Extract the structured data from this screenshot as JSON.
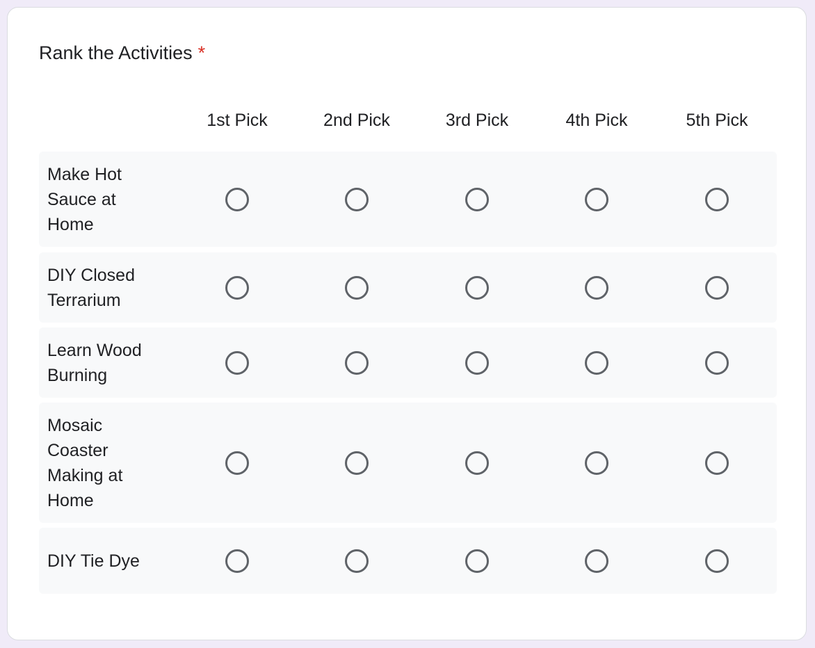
{
  "question": {
    "title": "Rank the Activities",
    "required_marker": "*"
  },
  "columns": [
    "1st Pick",
    "2nd Pick",
    "3rd Pick",
    "4th Pick",
    "5th Pick"
  ],
  "rows": [
    {
      "label": "Make Hot Sauce at Home",
      "selected": null
    },
    {
      "label": "DIY Closed Terrarium",
      "selected": null
    },
    {
      "label": "Learn Wood Burning",
      "selected": null
    },
    {
      "label": "Mosaic Coaster Making at Home",
      "selected": null
    },
    {
      "label": "DIY Tie Dye",
      "selected": null
    }
  ],
  "colors": {
    "page_background": "#f0ebf8",
    "card_background": "#ffffff",
    "row_background": "#f8f9fa",
    "required": "#d93025",
    "radio_border": "#5f6368"
  }
}
